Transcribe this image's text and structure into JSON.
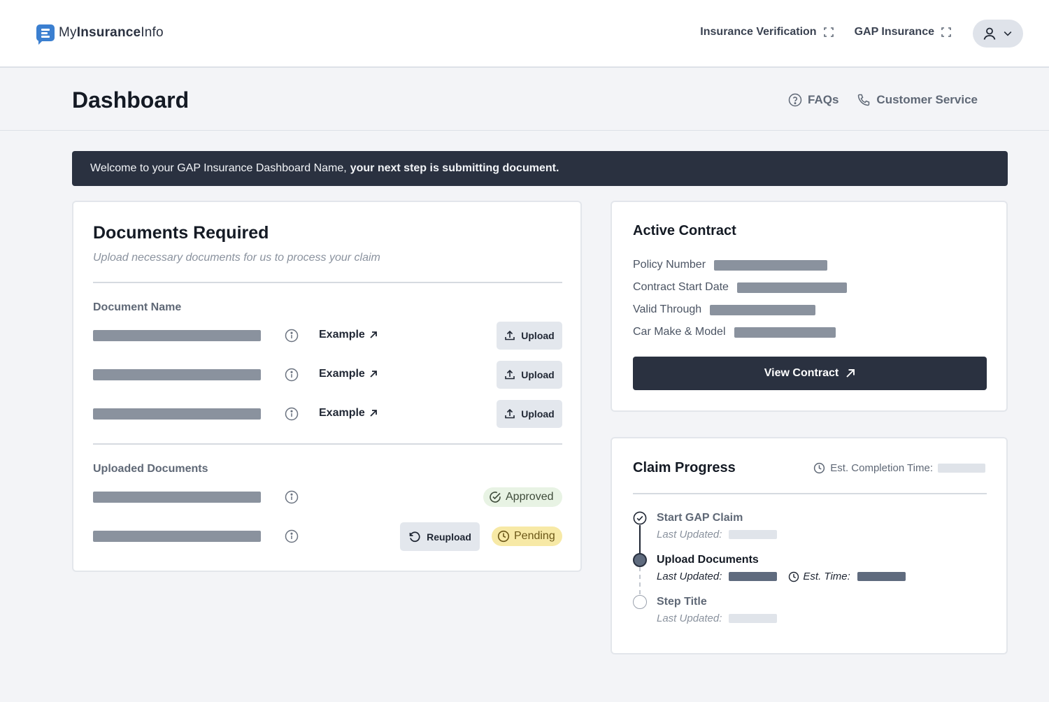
{
  "app": {
    "logo_prefix": "My",
    "logo_bold": "Insurance",
    "logo_suffix": "Info"
  },
  "nav": {
    "links": [
      {
        "label": "Insurance Verification",
        "icon": "expand-icon"
      },
      {
        "label": "GAP Insurance",
        "icon": "expand-icon"
      }
    ],
    "user_icon": "user-icon",
    "user_menu_icon": "chevron-down-icon"
  },
  "header": {
    "title": "Dashboard",
    "links": [
      {
        "label": "FAQs",
        "icon": "help-circle-icon"
      },
      {
        "label": "Customer Service",
        "icon": "phone-icon"
      }
    ]
  },
  "banner": {
    "text": "Welcome to your GAP Insurance Dashboard Name,",
    "emphasis": "your next step is submitting document."
  },
  "documents": {
    "title": "Documents Required",
    "subtitle": "Upload necessary documents for us to process your claim",
    "required_label": "Document Name",
    "example_label": "Example",
    "upload_label": "Upload",
    "uploaded_label": "Uploaded Documents",
    "reupload_label": "Reupload",
    "statuses": {
      "approved": "Approved",
      "pending": "Pending"
    }
  },
  "contract": {
    "title": "Active Contract",
    "fields": [
      "Policy Number",
      "Contract Start Date",
      "Valid Through",
      "Car Make & Model"
    ],
    "view_label": "View Contract"
  },
  "progress": {
    "title": "Claim Progress",
    "est_completion_label": "Est. Completion Time:",
    "steps": [
      {
        "title": "Start GAP Claim",
        "status": "complete",
        "updated_label": "Last Updated:"
      },
      {
        "title": "Upload Documents",
        "status": "current",
        "updated_label": "Last Updated:",
        "est_label": "Est. Time:"
      },
      {
        "title": "Step Title",
        "status": "upcoming",
        "updated_label": "Last Updated:"
      }
    ]
  },
  "colors": {
    "primary_dark": "#2a3140",
    "brand_blue": "#3b7fd0",
    "approved_bg": "#e8f3e4",
    "pending_bg": "#f7e9a6",
    "placeholder_bar": "#8a929e"
  }
}
